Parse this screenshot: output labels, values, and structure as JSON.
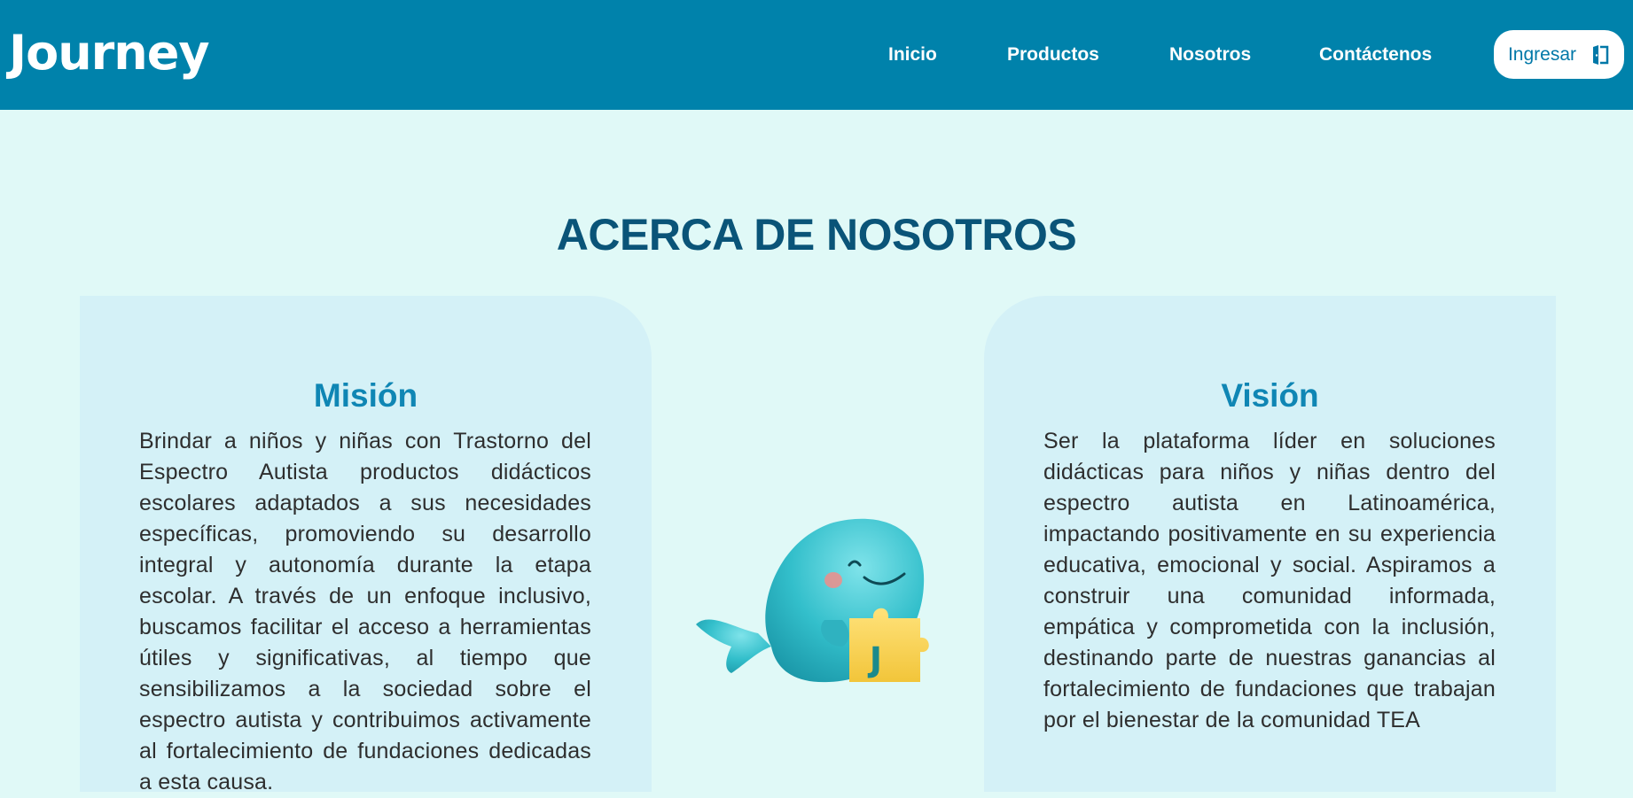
{
  "brand": {
    "logo_text": "Journey"
  },
  "nav": {
    "links": [
      "Inicio",
      "Productos",
      "Nosotros",
      "Contáctenos"
    ],
    "login_label": "Ingresar"
  },
  "main": {
    "title": "ACERCA DE NOSOTROS",
    "mission": {
      "title": "Misión",
      "text": "Brindar a niños y niñas con Trastorno del Espectro Autista productos didácticos escolares adaptados a sus necesidades específicas, promoviendo su desarrollo integral y autonomía durante la etapa escolar. A través de un enfoque inclusivo, buscamos facilitar el acceso a herramientas útiles y significativas, al tiempo que sensibilizamos a la sociedad sobre el espectro autista y contribuimos activamente al fortalecimiento de fundaciones dedicadas a esta causa."
    },
    "vision": {
      "title": "Visión",
      "text": "Ser la plataforma líder en soluciones didácticas para niños y niñas dentro del espectro autista en Latinoamérica, impactando positivamente en su experiencia educativa, emocional y social. Aspiramos a construir una comunidad informada, empática y comprometida con la inclusión, destinando parte de nuestras ganancias al fortalecimiento de fundaciones que trabajan por el bienestar de la comunidad TEA"
    },
    "mascot": {
      "puzzle_letter": "J"
    }
  },
  "colors": {
    "navbar": "#0082ab",
    "background": "#e0f9f7",
    "card": "#d4f1f7",
    "title": "#0a5478",
    "accent": "#0f86b4"
  },
  "icons": {
    "login": "door-exit-icon",
    "mascot": "whale-mascot-icon"
  }
}
